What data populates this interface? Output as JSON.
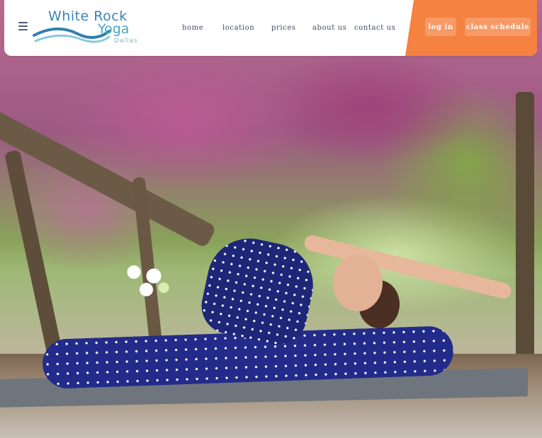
{
  "brand": {
    "line1": "White Rock",
    "line2": "Yoga",
    "line3": "Dallas",
    "colors": {
      "white_rock": "#3a86b4",
      "yoga": "#46a7c4",
      "dallas": "#7fb4cc",
      "wave_dark": "#2f7fae",
      "wave_light": "#89c9d9"
    }
  },
  "header": {
    "menu_icon": "hamburger-menu-icon",
    "nav": [
      {
        "label": "home"
      },
      {
        "label": "location"
      },
      {
        "label": "prices"
      },
      {
        "label": "about us"
      },
      {
        "label": "contact us"
      }
    ],
    "login_label": "log in",
    "schedule_label": "class schedule",
    "accent_color": "#f58240"
  },
  "hero": {
    "image": "hero-yoga-photo"
  }
}
